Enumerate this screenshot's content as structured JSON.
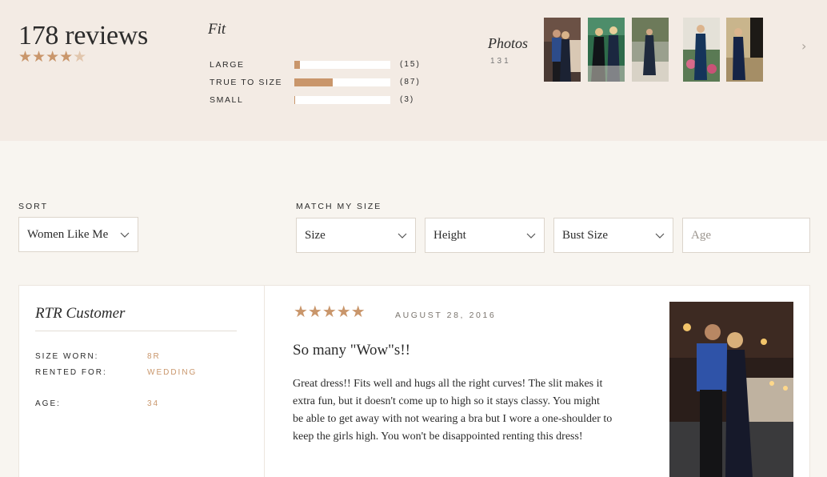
{
  "summary": {
    "review_count": "178 reviews",
    "rating_stars": "★★★★",
    "rating_half": "★",
    "fit": {
      "title": "Fit",
      "rows": [
        {
          "label": "LARGE",
          "count": "(15)",
          "fraction": 0.06
        },
        {
          "label": "TRUE TO SIZE",
          "count": "(87)",
          "fraction": 0.4
        },
        {
          "label": "SMALL",
          "count": "(3)",
          "fraction": 0.01
        }
      ]
    },
    "photos": {
      "title": "Photos",
      "count": "131",
      "next_icon": "chevron-right-icon"
    }
  },
  "filters": {
    "sort_label": "SORT",
    "sort_value": "Women Like Me",
    "match_label": "MATCH MY SIZE",
    "size": "Size",
    "height": "Height",
    "bust_size": "Bust Size",
    "age_placeholder": "Age"
  },
  "review": {
    "reviewer": "RTR Customer",
    "attributes": [
      {
        "key": "SIZE WORN:",
        "value": "8R"
      },
      {
        "key": "RENTED FOR:",
        "value": "WEDDING"
      },
      {
        "key": "AGE:",
        "value": "34"
      }
    ],
    "stars": "★★★★★",
    "date": "AUGUST 28, 2016",
    "title": "So many \"Wow\"s!!",
    "body": "Great dress!! Fits well and hugs all the right curves! The slit makes it extra fun, but it doesn't come up to high so it stays classy. You might be able to get away with not wearing a bra but I wore a one-shoulder to keep the girls high. You won't be disappointed renting this dress!"
  },
  "colors": {
    "accent": "#c9966b",
    "summary_bg": "#f3ebe4",
    "page_bg": "#f8f5f0"
  }
}
